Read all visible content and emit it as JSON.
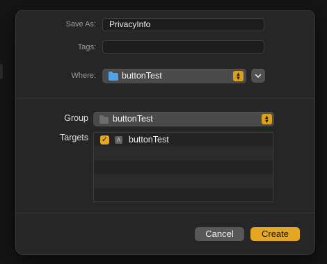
{
  "save_as": {
    "label": "Save As:",
    "value": "PrivacyInfo"
  },
  "tags": {
    "label": "Tags:",
    "value": ""
  },
  "where": {
    "label": "Where:",
    "value": "buttonTest"
  },
  "group": {
    "label": "Group",
    "value": "buttonTest"
  },
  "targets": {
    "label": "Targets",
    "items": [
      {
        "label": "buttonTest",
        "checked": true
      }
    ]
  },
  "buttons": {
    "cancel": "Cancel",
    "create": "Create"
  },
  "colors": {
    "accent": "#e3a724",
    "folder": "#4ca3ee"
  },
  "icons": [
    "folder-icon",
    "chevron-updown-icon",
    "chevron-down-icon",
    "checkmark-icon",
    "app-icon"
  ]
}
